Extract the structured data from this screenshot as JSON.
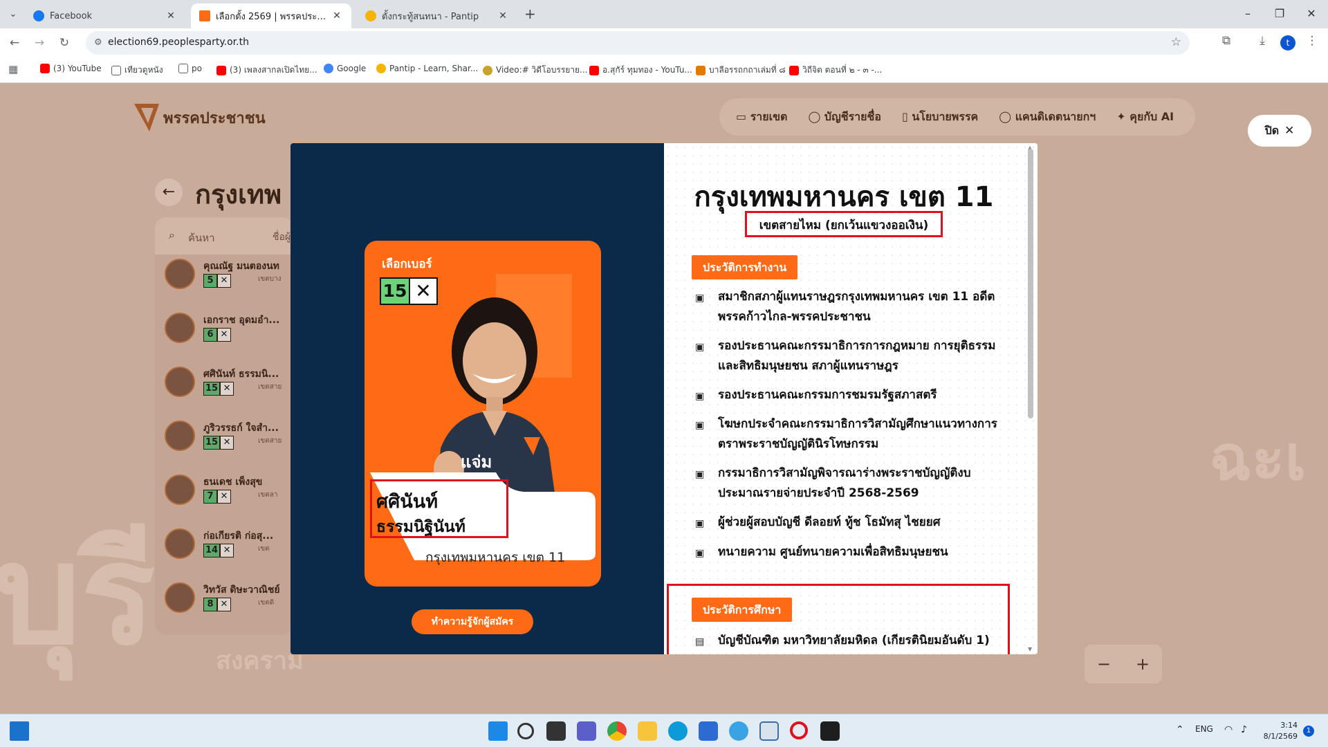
{
  "browser": {
    "tabs": [
      {
        "title": "Facebook",
        "favicon_color": "#1877f2",
        "active": false
      },
      {
        "title": "เลือกตั้ง 2569 | พรรคประชาชน",
        "favicon_color": "#ff6b14",
        "active": true
      },
      {
        "title": "ตั้งกระทู้สนทนา - Pantip",
        "favicon_color": "#f5b400",
        "active": false
      }
    ],
    "new_tab": "+",
    "url": "election69.peoplesparty.or.th",
    "profile_initial": "t",
    "bookmarks": [
      {
        "label": "(3) YouTube",
        "icon_color": "#ff0000"
      },
      {
        "label": "เทียวดูหนัง",
        "icon_color": "#5f6368"
      },
      {
        "label": "po",
        "icon_color": "#5f6368"
      },
      {
        "label": "(3) เพลงสากลเปิดไทย...",
        "icon_color": "#ff0000"
      },
      {
        "label": "Google",
        "icon_color": "#4285f4"
      },
      {
        "label": "Pantip - Learn, Shar...",
        "icon_color": "#f5b400"
      },
      {
        "label": "Video:# วิดีโอบรรยาย...",
        "icon_color": "#c9a227"
      },
      {
        "label": "อ.สุกัร์ ทุมทอง - YouTu...",
        "icon_color": "#ff0000"
      },
      {
        "label": "บาลีอรรถกถาเล่มที่ ๘",
        "icon_color": "#e07b00"
      },
      {
        "label": "วิถีจิต ตอนที่ ๒ - ๓ -...",
        "icon_color": "#ff0000"
      }
    ]
  },
  "site": {
    "logo_text": "พรรคประชาชน",
    "nav": [
      "รายเขต",
      "บัญชีรายชื่อ",
      "นโยบายพรรค",
      "แคนดิเดตนายกฯ",
      "คุยกับ AI"
    ],
    "page_title": "กรุงเทพ",
    "search_placeholder": "ค้นหา",
    "search_hint": "ชื่อผู้",
    "close_label": "ปิด",
    "zoom_out": "−",
    "zoom_in": "+",
    "bg_words": [
      "บุรี",
      "ฉะเ",
      "สงคราม"
    ],
    "candidates": [
      {
        "name": "คุณณัฐ มนตองนท",
        "number": "5",
        "district": "เขตบาง"
      },
      {
        "name": "เอกราช อุดมอำ...",
        "number": "6",
        "district": ""
      },
      {
        "name": "ศศินันท์ ธรรมนิ...",
        "number": "15",
        "district": "เขตสาย"
      },
      {
        "name": "ภูริวรรธก์ ใจสำ...",
        "number": "15",
        "district": "เขตสาย"
      },
      {
        "name": "ธนเดช เพ็งสุข",
        "number": "7",
        "district": "เขตลา"
      },
      {
        "name": "ก่อเกียรติ ก่อสุ...",
        "number": "14",
        "district": "เขต"
      },
      {
        "name": "วิทวัส ดิษะวาณิชย์",
        "number": "8",
        "district": "เขตดิ"
      }
    ]
  },
  "modal": {
    "card": {
      "pick_label": "เลือกเบอร์",
      "ballot_number": "15",
      "ballot_mark": "✕",
      "nickname": "แจ่ม",
      "first_name": "ศศินันท์",
      "last_name": "ธรรมนิฐินันท์",
      "district": "กรุงเทพมหานคร เขต 11"
    },
    "learn_button": "ทำความรู้จักผู้สมัคร",
    "district_title": "กรุงเทพมหานคร เขต 11",
    "district_sub": "เขตสายไหม (ยกเว้นแขวงออเงิน)",
    "work_heading": "ประวัติการทำงาน",
    "work_items": [
      "สมาชิกสภาผู้แทนราษฎรกรุงเทพมหานคร เขต 11 อดีตพรรคก้าวไกล-พรรคประชาชน",
      "รองประธานคณะกรรมาธิการการกฎหมาย การยุติธรรม และสิทธิมนุษยชน สภาผู้แทนราษฎร",
      "รองประธานคณะกรรมการชมรมรัฐสภาสตรี",
      "โฆษกประจำคณะกรรมาธิการวิสามัญศึกษาแนวทางการตราพระราชบัญญัตินิรโทษกรรม",
      "กรรมาธิการวิสามัญพิจารณาร่างพระราชบัญญัติงบประมาณรายจ่ายประจำปี 2568-2569",
      "ผู้ช่วยผู้สอบบัญชี ดีลอยท์ ทู้ช โธมัทสุ ไชยยศ",
      "ทนายความ ศูนย์ทนายความเพื่อสิทธิมนุษยชน"
    ],
    "edu_heading": "ประวัติการศึกษา",
    "edu_items": [
      "บัญชีบัณฑิต มหาวิทยาลัยมหิดล (เกียรตินิยมอันดับ 1)"
    ]
  },
  "taskbar": {
    "lang": "ENG",
    "time": "3:14",
    "date": "8/1/2569",
    "notif_count": "1"
  },
  "colors": {
    "brand_orange": "#ff6b14",
    "modal_navy": "#0b2a4a",
    "highlight_red": "#e0101e",
    "ballot_green": "#6cd37a"
  }
}
